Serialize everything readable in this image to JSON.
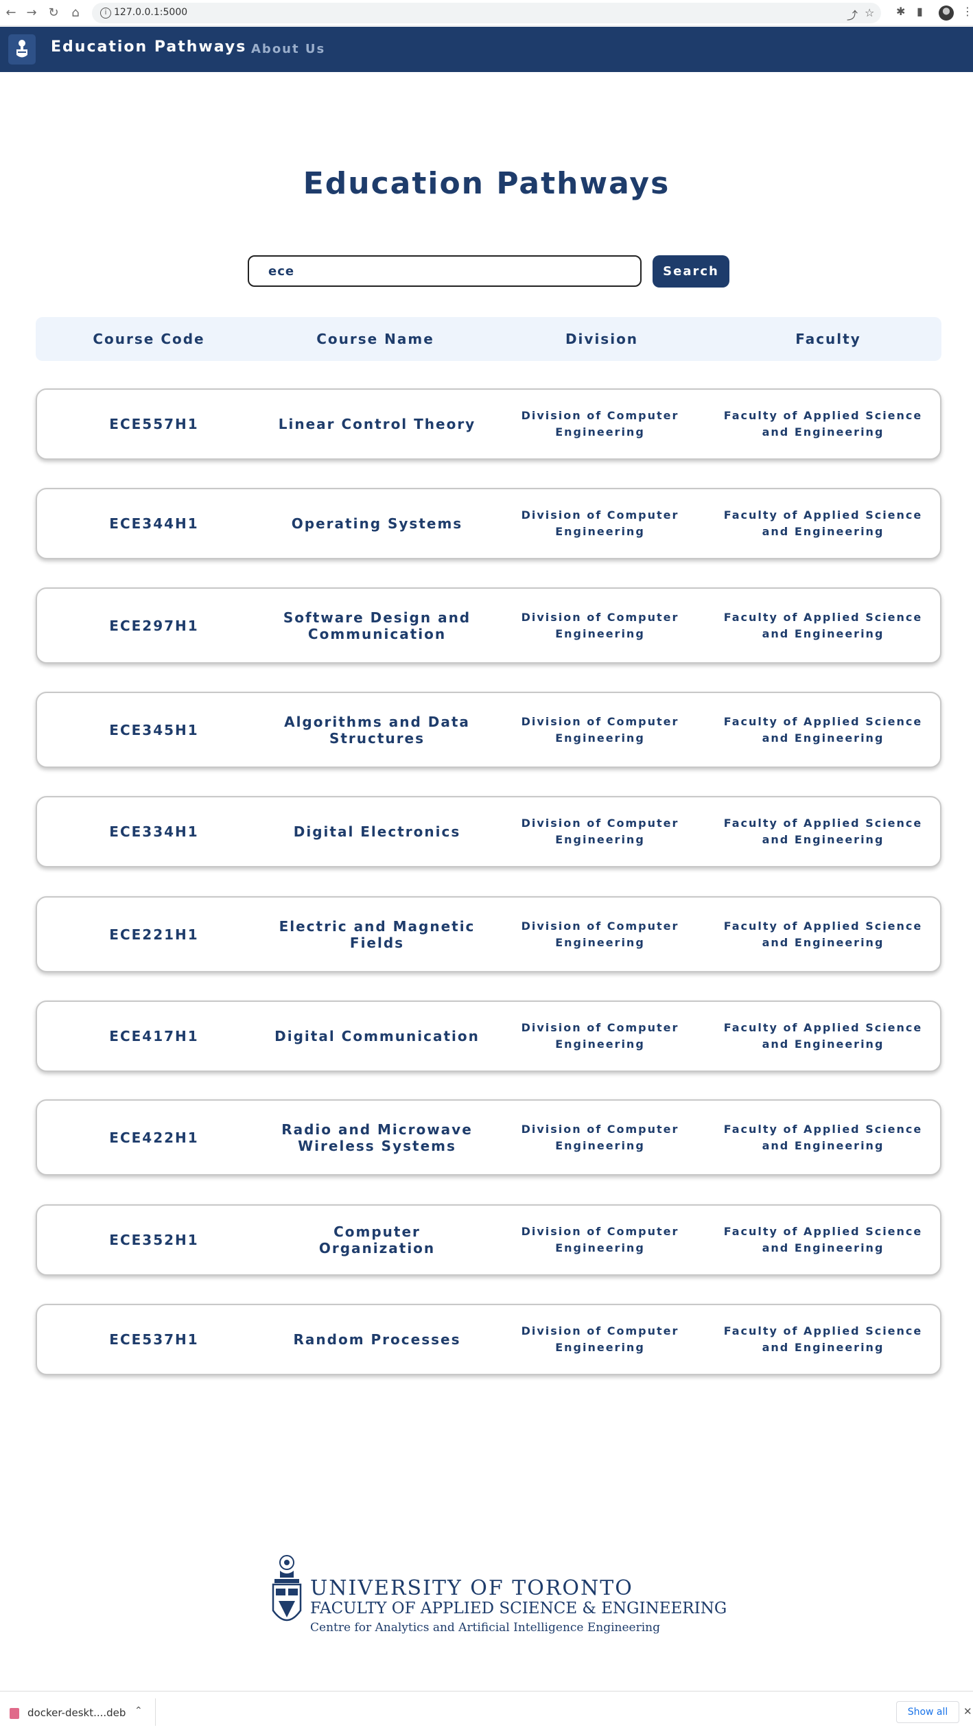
{
  "browser": {
    "url": "127.0.0.1:5000"
  },
  "navbar": {
    "brand": "Education Pathways",
    "about_link": "About Us"
  },
  "page": {
    "title": "Education Pathways"
  },
  "search": {
    "value": "ece",
    "button_label": "Search"
  },
  "table": {
    "headers": [
      "Course Code",
      "Course Name",
      "Division",
      "Faculty"
    ],
    "rows": [
      {
        "code": "ECE557H1",
        "name": "Linear Control Theory",
        "division": "Division of Computer Engineering",
        "faculty": "Faculty of Applied Science and Engineering"
      },
      {
        "code": "ECE344H1",
        "name": "Operating Systems",
        "division": "Division of Computer Engineering",
        "faculty": "Faculty of Applied Science and Engineering"
      },
      {
        "code": "ECE297H1",
        "name": "Software Design and Communication",
        "division": "Division of Computer Engineering",
        "faculty": "Faculty of Applied Science and Engineering"
      },
      {
        "code": "ECE345H1",
        "name": "Algorithms and Data Structures",
        "division": "Division of Computer Engineering",
        "faculty": "Faculty of Applied Science and Engineering"
      },
      {
        "code": "ECE334H1",
        "name": "Digital Electronics",
        "division": "Division of Computer Engineering",
        "faculty": "Faculty of Applied Science and Engineering"
      },
      {
        "code": "ECE221H1",
        "name": "Electric and Magnetic Fields",
        "division": "Division of Computer Engineering",
        "faculty": "Faculty of Applied Science and Engineering"
      },
      {
        "code": "ECE417H1",
        "name": "Digital Communication",
        "division": "Division of Computer Engineering",
        "faculty": "Faculty of Applied Science and Engineering"
      },
      {
        "code": "ECE422H1",
        "name": "Radio and Microwave Wireless Systems",
        "division": "Division of Computer Engineering",
        "faculty": "Faculty of Applied Science and Engineering"
      },
      {
        "code": "ECE352H1",
        "name": "Computer Organization",
        "division": "Division of Computer Engineering",
        "faculty": "Faculty of Applied Science and Engineering"
      },
      {
        "code": "ECE537H1",
        "name": "Random Processes",
        "division": "Division of Computer Engineering",
        "faculty": "Faculty of Applied Science and Engineering"
      }
    ]
  },
  "footer": {
    "line1": "UNIVERSITY OF TORONTO",
    "line2": "FACULTY OF APPLIED SCIENCE & ENGINEERING",
    "line3": "Centre for Analytics and Artificial Intelligence Engineering"
  },
  "downloads": {
    "file_name": "docker-deskt....deb",
    "show_all": "Show all"
  },
  "colors": {
    "primary": "#1e3c6b",
    "header_bg": "#eef4fc"
  }
}
